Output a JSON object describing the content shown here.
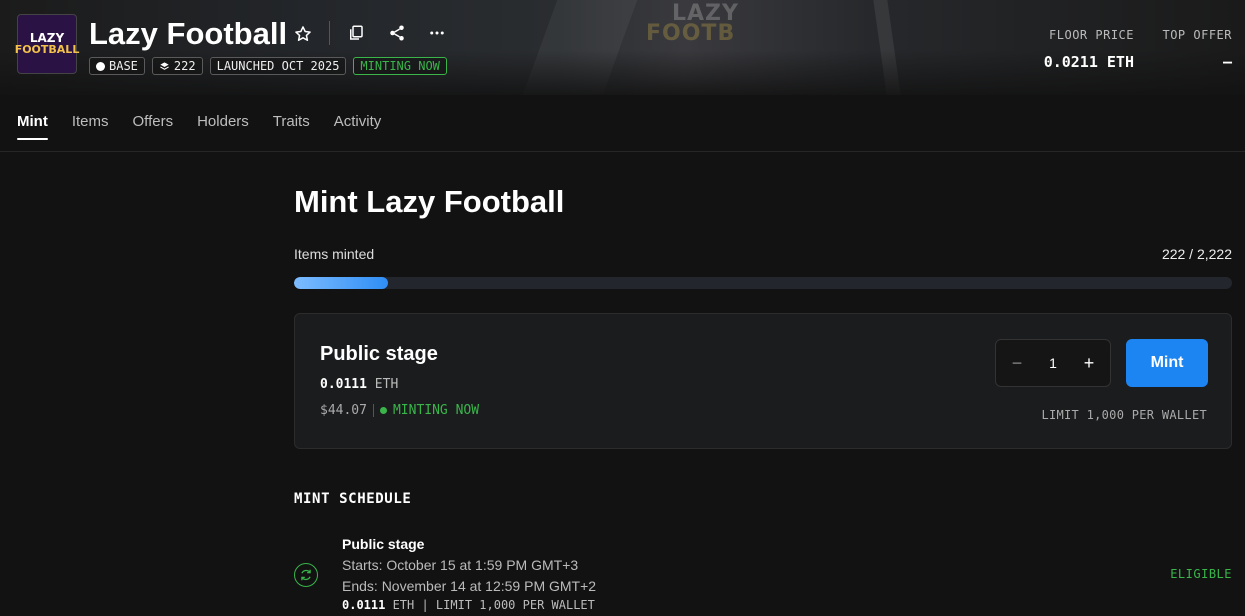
{
  "collection": {
    "logo_text_top": "LAZY",
    "logo_text_bottom": "FOOTBALL",
    "name": "Lazy Football",
    "badges": {
      "chain": "BASE",
      "count": "222",
      "launched": "LAUNCHED OCT 2025",
      "status": "MINTING NOW"
    }
  },
  "stats": {
    "floor_label": "FLOOR PRICE",
    "floor_value": "0.0211 ETH",
    "offer_label": "TOP OFFER",
    "offer_value": "–"
  },
  "tabs": [
    {
      "label": "Mint",
      "active": true
    },
    {
      "label": "Items",
      "active": false
    },
    {
      "label": "Offers",
      "active": false
    },
    {
      "label": "Holders",
      "active": false
    },
    {
      "label": "Traits",
      "active": false
    },
    {
      "label": "Activity",
      "active": false
    }
  ],
  "mint": {
    "title": "Mint Lazy Football",
    "progress_label": "Items minted",
    "progress_value": "222 / 2,222",
    "progress_fraction": 0.1,
    "stage": {
      "name": "Public stage",
      "price": "0.0111",
      "currency": "ETH",
      "usd": "$44.07",
      "status": "MINTING NOW",
      "quantity": "1",
      "minus": "−",
      "plus": "+",
      "mint_label": "Mint",
      "limit": "LIMIT 1,000 PER WALLET"
    }
  },
  "schedule": {
    "title": "MINT SCHEDULE",
    "stage": {
      "name": "Public stage",
      "starts": "Starts: October 15 at 1:59 PM GMT+3",
      "ends": "Ends: November 14 at 12:59 PM GMT+2",
      "price": "0.0111",
      "price_rest": " ETH | LIMIT 1,000 PER WALLET",
      "eligibility": "ELIGIBLE"
    }
  },
  "colors": {
    "accent": "#1d85f2",
    "status_green": "#39b54a"
  }
}
